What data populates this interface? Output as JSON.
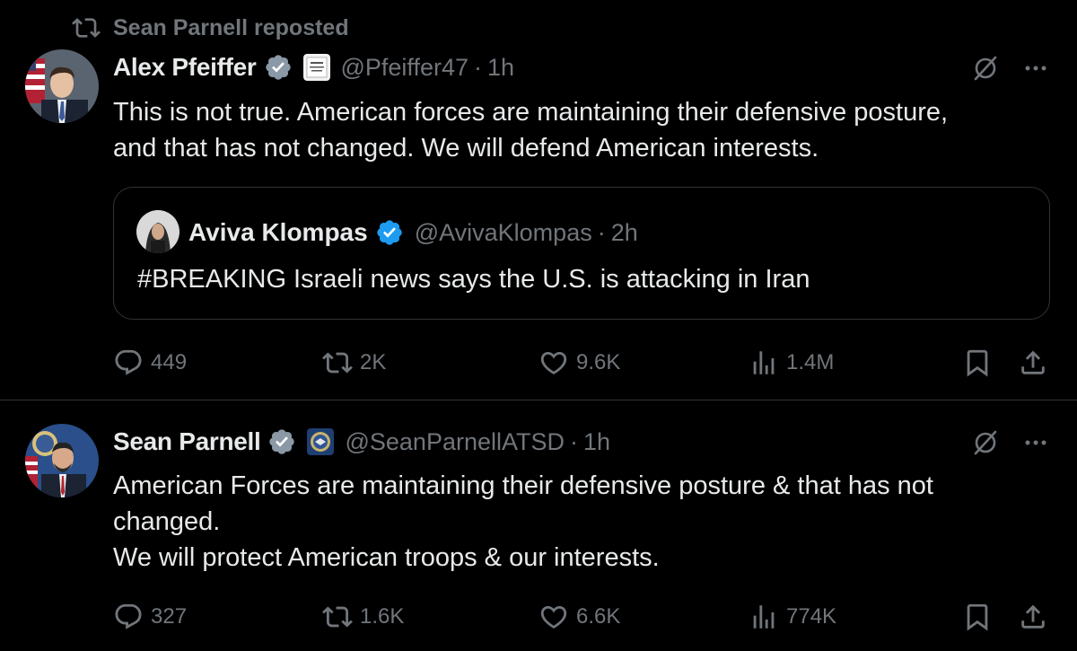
{
  "repost": {
    "text": "Sean Parnell reposted",
    "icon": "retweet-icon"
  },
  "tweets": [
    {
      "author_name": "Alex Pfeiffer",
      "handle": "@Pfeiffer47",
      "separator": "·",
      "time": "1h",
      "affiliation_icon": "white-house-badge",
      "text_lines": [
        "This is not true. American forces are maintaining their defensive posture,",
        "and that has not changed. We will defend American interests."
      ],
      "quote": {
        "author_name": "Aviva Klompas",
        "handle": "@AvivaKlompas",
        "separator": "·",
        "time": "2h",
        "text": "#BREAKING Israeli news says the U.S. is attacking in Iran"
      },
      "stats": {
        "replies": "449",
        "reposts": "2K",
        "likes": "9.6K",
        "views": "1.4M"
      }
    },
    {
      "author_name": "Sean Parnell",
      "handle": "@SeanParnellATSD",
      "separator": "·",
      "time": "1h",
      "affiliation_icon": "department-seal-badge",
      "text_lines": [
        "American Forces are maintaining their defensive posture & that has not",
        "changed.",
        "We will protect American troops & our interests."
      ],
      "stats": {
        "replies": "327",
        "reposts": "1.6K",
        "likes": "6.6K",
        "views": "774K"
      }
    }
  ],
  "colors": {
    "background": "#000000",
    "text_primary": "#e7e9ea",
    "text_secondary": "#71767b",
    "verified": "#1d9bf0",
    "border": "#2f3336"
  }
}
